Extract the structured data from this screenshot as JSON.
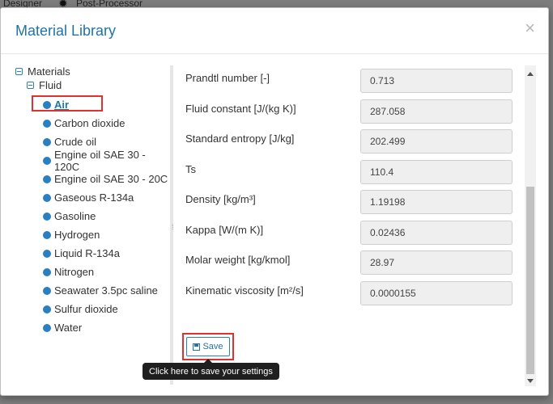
{
  "background": {
    "tab_designer": "Designer",
    "tab_post": "Post-Processor"
  },
  "modal": {
    "title": "Material Library",
    "close_symbol": "×"
  },
  "tree": {
    "root_label": "Materials",
    "group_label": "Fluid",
    "items": [
      {
        "label": "Air",
        "selected": true
      },
      {
        "label": "Carbon dioxide"
      },
      {
        "label": "Crude oil"
      },
      {
        "label": "Engine oil SAE 30 - 120C"
      },
      {
        "label": "Engine oil SAE 30 - 20C"
      },
      {
        "label": "Gaseous R-134a"
      },
      {
        "label": "Gasoline"
      },
      {
        "label": "Hydrogen"
      },
      {
        "label": "Liquid R-134a"
      },
      {
        "label": "Nitrogen"
      },
      {
        "label": "Seawater 3.5pc saline"
      },
      {
        "label": "Sulfur dioxide"
      },
      {
        "label": "Water"
      }
    ]
  },
  "properties": [
    {
      "label": "Prandtl number [-]",
      "value": "0.713"
    },
    {
      "label": "Fluid constant [J/(kg K)]",
      "value": "287.058"
    },
    {
      "label": "Standard entropy [J/kg]",
      "value": "202.499"
    },
    {
      "label": "Ts",
      "value": "110.4"
    },
    {
      "label": "Density [kg/m³]",
      "value": "1.19198"
    },
    {
      "label": "Kappa [W/(m K)]",
      "value": "0.02436"
    },
    {
      "label": "Molar weight [kg/kmol]",
      "value": "28.97"
    },
    {
      "label": "Kinematic viscosity [m²/s]",
      "value": "0.0000155"
    }
  ],
  "save": {
    "label": "Save",
    "tooltip": "Click here to save your settings"
  },
  "colors": {
    "accent": "#2173a8",
    "highlight": "#e03030"
  }
}
